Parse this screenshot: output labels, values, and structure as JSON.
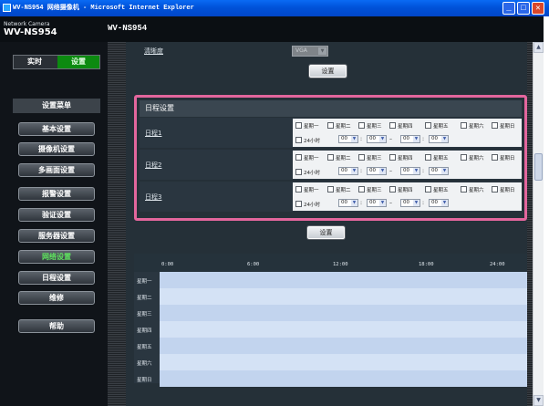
{
  "window": {
    "title": "WV-NS954 网络摄像机 - Microsoft Internet Explorer"
  },
  "header": {
    "network_camera": "Network Camera",
    "model_left": "WV-NS954",
    "model_center": "WV-NS954"
  },
  "mode": {
    "live": "实时",
    "setup": "设置"
  },
  "menu": {
    "title": "设置菜单",
    "items": [
      "基本设置",
      "摄像机设置",
      "多画面设置",
      "报警设置",
      "验证设置",
      "服务器设置",
      "网络设置",
      "日程设置",
      "维修"
    ],
    "active": "网络设置",
    "help": "帮助"
  },
  "resolution": {
    "label": "清晰度",
    "value": "VGA"
  },
  "buttons": {
    "set": "设置"
  },
  "schedule": {
    "title": "日程设置",
    "days": [
      "星期一",
      "星期二",
      "星期三",
      "星期四",
      "星期五",
      "星期六",
      "星期日"
    ],
    "all_day": "24小时",
    "rows": [
      {
        "label": "日程1",
        "start_h": "00",
        "start_m": "00",
        "end_h": "00",
        "end_m": "00"
      },
      {
        "label": "日程2",
        "start_h": "00",
        "start_m": "00",
        "end_h": "00",
        "end_m": "00"
      },
      {
        "label": "日程3",
        "start_h": "00",
        "start_m": "00",
        "end_h": "00",
        "end_m": "00"
      }
    ]
  },
  "timeline": {
    "ticks": [
      "0:00",
      "6:00",
      "12:00",
      "18:00",
      "24:00"
    ],
    "days": [
      "星期一",
      "星期二",
      "星期三",
      "星期四",
      "星期五",
      "星期六",
      "星期日"
    ]
  },
  "colors": {
    "accent_green": "#0c8a10",
    "highlight_pink": "#e3669d",
    "timeline_a": "#c2d4ee",
    "timeline_b": "#d4e2f5"
  }
}
